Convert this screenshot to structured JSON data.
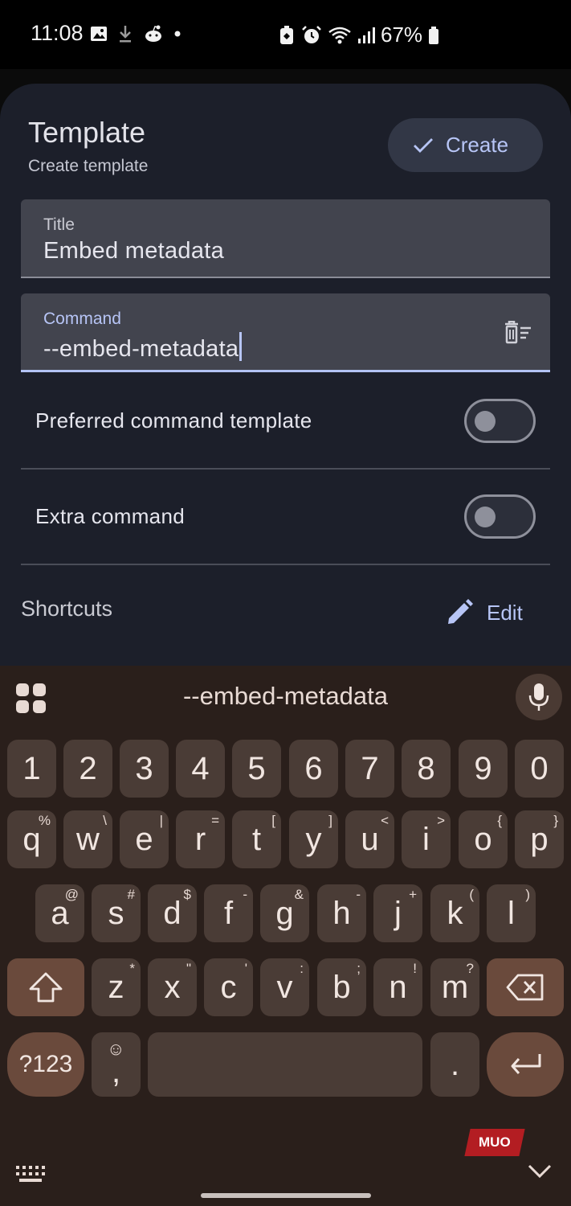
{
  "status_bar": {
    "time": "11:08",
    "battery": "67%",
    "left_icons": [
      "gallery-icon",
      "download-icon",
      "reddit-icon",
      "dot-icon"
    ],
    "right_icons": [
      "battery-saver-icon",
      "alarm-icon",
      "wifi-icon",
      "signal-icon",
      "battery-icon"
    ]
  },
  "sheet": {
    "title": "Template",
    "subtitle": "Create template",
    "create_label": "Create",
    "fields": {
      "title": {
        "label": "Title",
        "value": "Embed metadata"
      },
      "command": {
        "label": "Command",
        "value": "--embed-metadata"
      }
    },
    "toggles": [
      {
        "label": "Preferred command template",
        "on": false
      },
      {
        "label": "Extra command",
        "on": false
      }
    ],
    "shortcuts_label": "Shortcuts",
    "edit_label": "Edit"
  },
  "keyboard": {
    "suggestion": "--embed-metadata",
    "number_row": [
      "1",
      "2",
      "3",
      "4",
      "5",
      "6",
      "7",
      "8",
      "9",
      "0"
    ],
    "row1": [
      {
        "key": "q",
        "hint": "%"
      },
      {
        "key": "w",
        "hint": "\\"
      },
      {
        "key": "e",
        "hint": "|"
      },
      {
        "key": "r",
        "hint": "="
      },
      {
        "key": "t",
        "hint": "["
      },
      {
        "key": "y",
        "hint": "]"
      },
      {
        "key": "u",
        "hint": "<"
      },
      {
        "key": "i",
        "hint": ">"
      },
      {
        "key": "o",
        "hint": "{"
      },
      {
        "key": "p",
        "hint": "}"
      }
    ],
    "row2": [
      {
        "key": "a",
        "hint": "@"
      },
      {
        "key": "s",
        "hint": "#"
      },
      {
        "key": "d",
        "hint": "$"
      },
      {
        "key": "f",
        "hint": "-"
      },
      {
        "key": "g",
        "hint": "&"
      },
      {
        "key": "h",
        "hint": "-"
      },
      {
        "key": "j",
        "hint": "+"
      },
      {
        "key": "k",
        "hint": "("
      },
      {
        "key": "l",
        "hint": ")"
      }
    ],
    "row3": [
      {
        "key": "z",
        "hint": "*"
      },
      {
        "key": "x",
        "hint": "\""
      },
      {
        "key": "c",
        "hint": "'"
      },
      {
        "key": "v",
        "hint": ":"
      },
      {
        "key": "b",
        "hint": ";"
      },
      {
        "key": "n",
        "hint": "!"
      },
      {
        "key": "m",
        "hint": "?"
      }
    ],
    "symbols_key": "?123",
    "comma_key": ",",
    "comma_hint": "☺",
    "period_key": ".",
    "watermark": "MUO"
  },
  "colors": {
    "sheet_bg": "#1c1f2a",
    "field_bg": "#42444e",
    "accent": "#b7c5f6",
    "keyboard_bg": "#2a1f1b",
    "key_bg": "#4a3c36",
    "key_accent_bg": "#6a4a3c"
  }
}
